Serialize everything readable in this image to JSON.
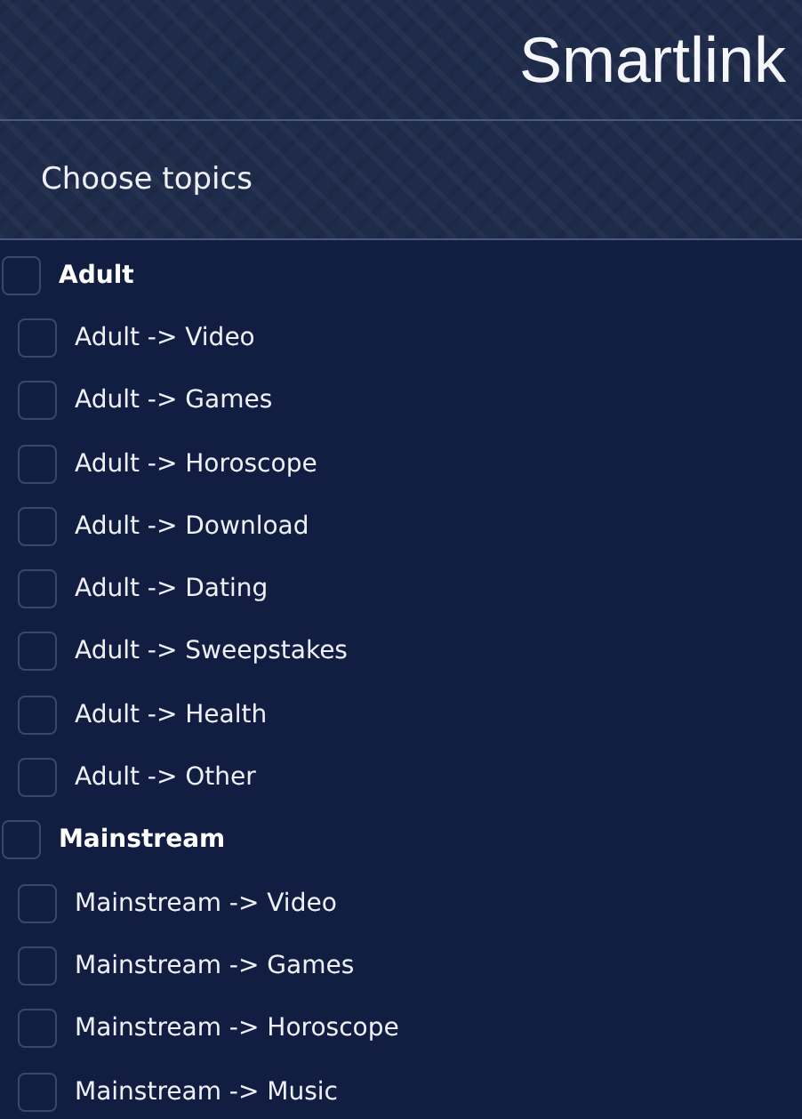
{
  "header": {
    "title": "Smartlink"
  },
  "section": {
    "title": "Choose topics"
  },
  "topics": [
    {
      "label": "Adult",
      "checked": false,
      "children": [
        {
          "label": "Adult -> Video",
          "checked": false
        },
        {
          "label": "Adult -> Games",
          "checked": false
        },
        {
          "label": "Adult -> Horoscope",
          "checked": false
        },
        {
          "label": "Adult -> Download",
          "checked": false
        },
        {
          "label": "Adult -> Dating",
          "checked": false
        },
        {
          "label": "Adult -> Sweepstakes",
          "checked": false
        },
        {
          "label": "Adult -> Health",
          "checked": false
        },
        {
          "label": "Adult -> Other",
          "checked": false
        }
      ]
    },
    {
      "label": "Mainstream",
      "checked": false,
      "children": [
        {
          "label": "Mainstream -> Video",
          "checked": false
        },
        {
          "label": "Mainstream -> Games",
          "checked": false
        },
        {
          "label": "Mainstream -> Horoscope",
          "checked": false
        },
        {
          "label": "Mainstream -> Music",
          "checked": false
        }
      ]
    }
  ]
}
